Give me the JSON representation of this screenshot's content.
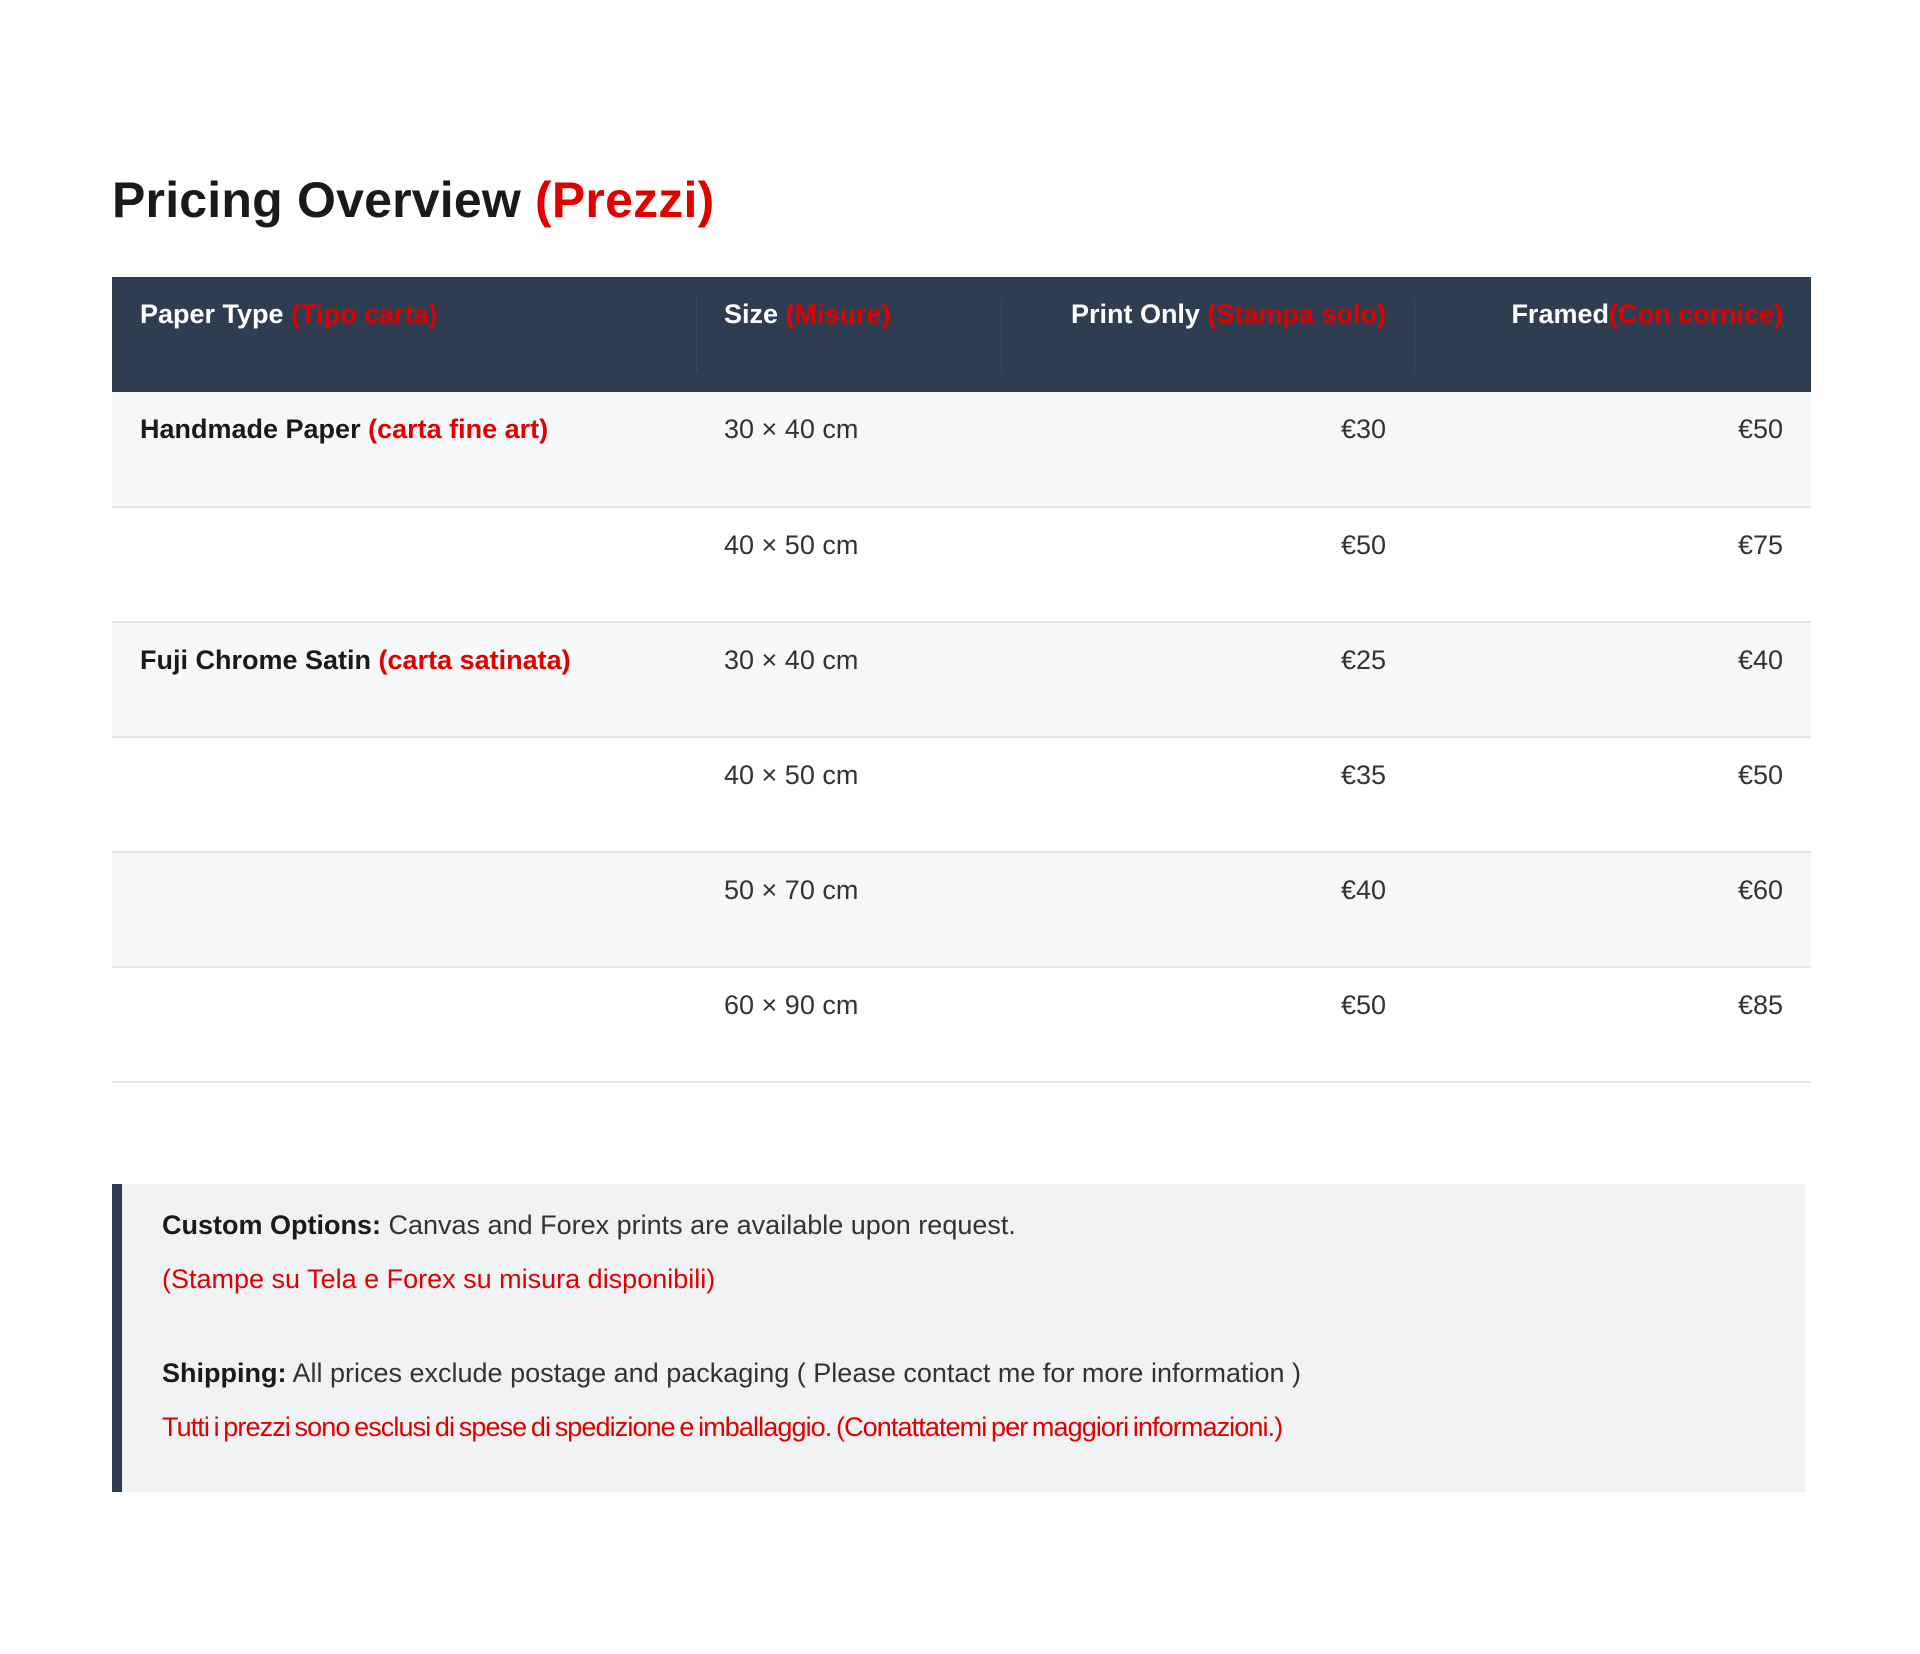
{
  "title": {
    "main": "Pricing Overview",
    "translation": "(Prezzi)"
  },
  "table": {
    "headers": [
      {
        "label": "Paper Type",
        "translation": "(Tipo carta)"
      },
      {
        "label": "Size",
        "translation": "(Misure)"
      },
      {
        "label": "Print Only",
        "translation": "(Stampa solo)"
      },
      {
        "label": "Framed",
        "translation": "(Con cornice)"
      }
    ],
    "rows": [
      {
        "paper": "Handmade Paper",
        "paper_translation": "(carta fine art)",
        "size": "30 × 40 cm",
        "print": "€30",
        "framed": "€50"
      },
      {
        "paper": "",
        "paper_translation": "",
        "size": "40 × 50 cm",
        "print": "€50",
        "framed": "€75"
      },
      {
        "paper": "Fuji Chrome Satin",
        "paper_translation": "(carta satinata)",
        "size": "30 × 40 cm",
        "print": "€25",
        "framed": "€40"
      },
      {
        "paper": "",
        "paper_translation": "",
        "size": "40 × 50 cm",
        "print": "€35",
        "framed": "€50"
      },
      {
        "paper": "",
        "paper_translation": "",
        "size": "50 × 70 cm",
        "print": "€40",
        "framed": "€60"
      },
      {
        "paper": "",
        "paper_translation": "",
        "size": "60 × 90 cm",
        "print": "€50",
        "framed": "€85"
      }
    ]
  },
  "info": {
    "custom_label": "Custom Options:",
    "custom_text": "Canvas and Forex prints are available upon request.",
    "custom_translation": "(Stampe su Tela e Forex su misura disponibili)",
    "shipping_label": "Shipping:",
    "shipping_text": "All prices exclude postage and packaging ( Please contact me for more information )",
    "shipping_translation": "Tutti  i prezzi sono esclusi di spese di spedizione e imballaggio. (Contattatemi  per maggiori informazioni.)"
  },
  "colors": {
    "header_bg": "#2e3e50",
    "accent_red": "#e00000",
    "alt_row_bg": "#f7f8fa",
    "info_bg": "#f1f2f4"
  }
}
